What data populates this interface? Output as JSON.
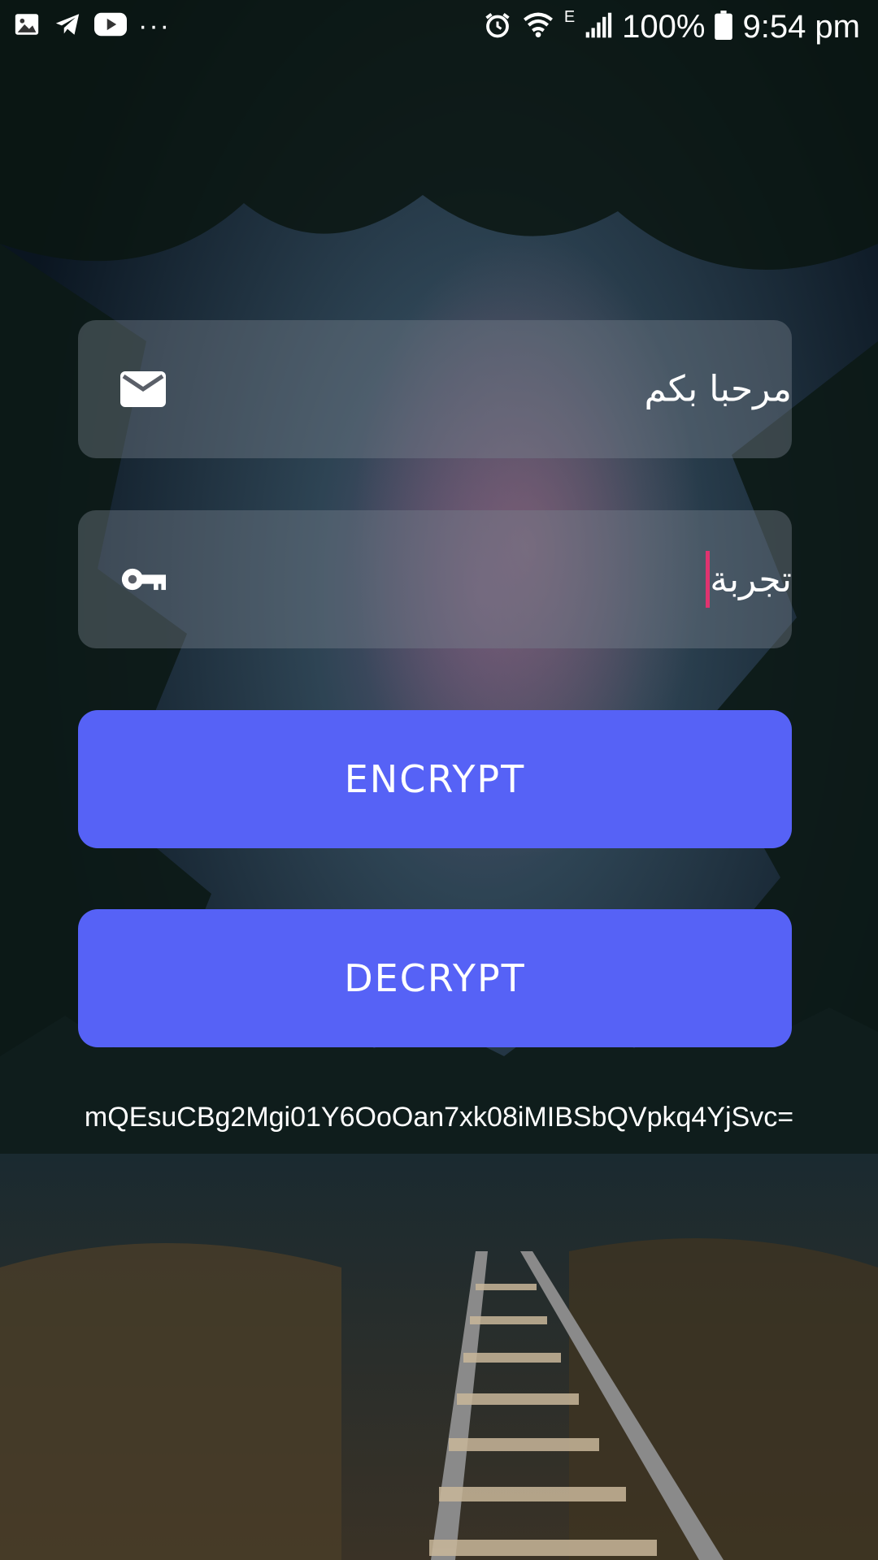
{
  "status_bar": {
    "left_icons": [
      "gallery-icon",
      "telegram-icon",
      "youtube-icon"
    ],
    "more_dots": "···",
    "right_icons": [
      "alarm-icon",
      "wifi-icon",
      "network-type-e-icon",
      "signal-icon",
      "battery-icon"
    ],
    "network_type": "E",
    "battery_percent": "100%",
    "time": "9:54 pm"
  },
  "form": {
    "message_field": {
      "value": "مرحبا بكم",
      "icon": "email-icon"
    },
    "key_field": {
      "value": "تجربة",
      "icon": "key-icon"
    },
    "encrypt_button": "ENCRYPT",
    "decrypt_button": "DECRYPT"
  },
  "result": {
    "text": "mQEsuCBg2Mgi01Y6OoOan7xk08iMIBSbQVpkq4YjSvc="
  },
  "colors": {
    "button_bg": "#5662f6",
    "caret": "#e0336f",
    "field_bg": "rgba(120,128,140,0.42)"
  }
}
